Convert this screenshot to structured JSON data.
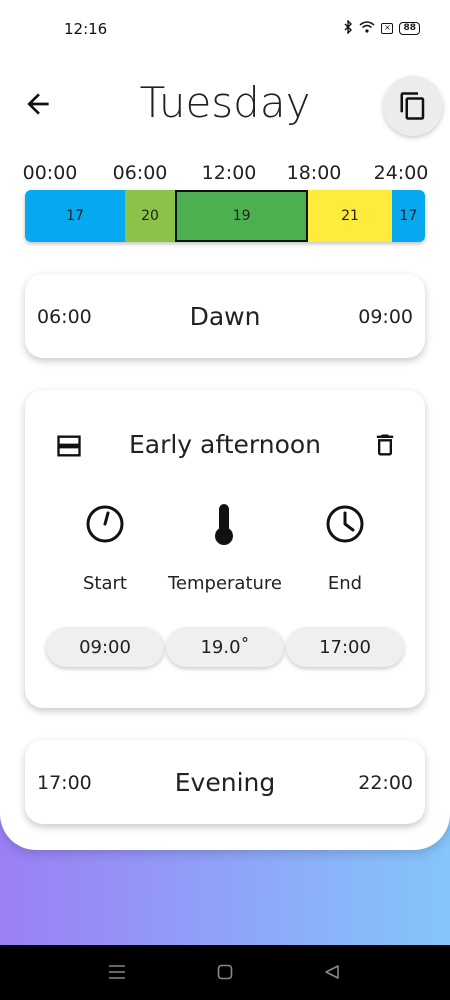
{
  "status": {
    "time": "12:16",
    "battery": "88"
  },
  "header": {
    "title": "Tuesday"
  },
  "timeline": {
    "ticks": [
      "00:00",
      "06:00",
      "12:00",
      "18:00",
      "24:00"
    ],
    "segments": [
      {
        "start": 0,
        "end": 6,
        "temp": "17",
        "color": "#06a9f0"
      },
      {
        "start": 6,
        "end": 9,
        "temp": "20",
        "color": "#8bc34a"
      },
      {
        "start": 9,
        "end": 17,
        "temp": "19",
        "color": "#4caf50",
        "selected": true
      },
      {
        "start": 17,
        "end": 22,
        "temp": "21",
        "color": "#ffeb3b"
      },
      {
        "start": 22,
        "end": 24,
        "temp": "17",
        "color": "#06a9f0"
      }
    ]
  },
  "periods": [
    {
      "name": "Dawn",
      "start": "06:00",
      "end": "09:00"
    },
    {
      "name": "Early afternoon",
      "start_label": "Start",
      "temp_label": "Temperature",
      "end_label": "End",
      "start": "09:00",
      "temperature": "19.0˚",
      "end": "17:00"
    },
    {
      "name": "Evening",
      "start": "17:00",
      "end": "22:00"
    }
  ]
}
